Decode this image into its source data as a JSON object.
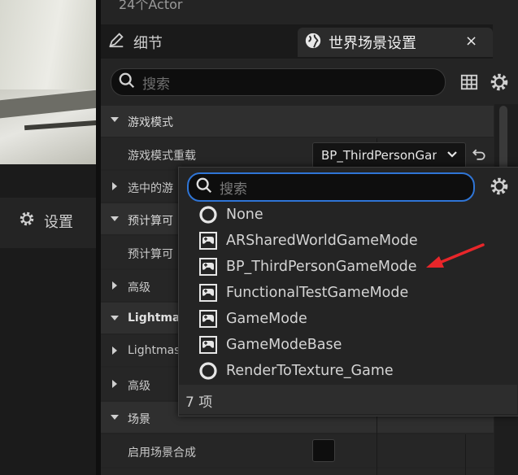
{
  "top": {
    "actor_count": "24个Actor"
  },
  "left": {
    "settings_label": "设置"
  },
  "tabs": {
    "details": "细节",
    "world_settings": "世界场景设置",
    "close_glyph": "×"
  },
  "search": {
    "placeholder": "搜索"
  },
  "properties": {
    "game_mode_category": "游戏模式",
    "game_mode_override": "游戏模式重载",
    "selected": "选中的游",
    "precomputed": "预计算可",
    "precomputed_sub": "预计算可",
    "advanced1": "高级",
    "lightmass_category": "Lightma",
    "lightmass_sub": "Lightmas",
    "advanced2": "高级",
    "scene_category": "场景",
    "enable_scene_composition": "启用场景合成"
  },
  "combo": {
    "value": "BP_ThirdPersonGameMode"
  },
  "popup": {
    "search_placeholder": "搜索",
    "options": [
      {
        "label": "None",
        "icon": "circle-icon"
      },
      {
        "label": "ARSharedWorldGameMode",
        "icon": "gamepad-icon"
      },
      {
        "label": "BP_ThirdPersonGameMode",
        "icon": "gamepad-icon"
      },
      {
        "label": "FunctionalTestGameMode",
        "icon": "gamepad-icon"
      },
      {
        "label": "GameMode",
        "icon": "gamepad-icon"
      },
      {
        "label": "GameModeBase",
        "icon": "gamepad-icon"
      },
      {
        "label": "RenderToTexture_Game",
        "icon": "circle-icon"
      }
    ],
    "count_label": "7 项"
  },
  "colors": {
    "focus_border": "#2f75d6",
    "arrow": "#e8262a"
  }
}
